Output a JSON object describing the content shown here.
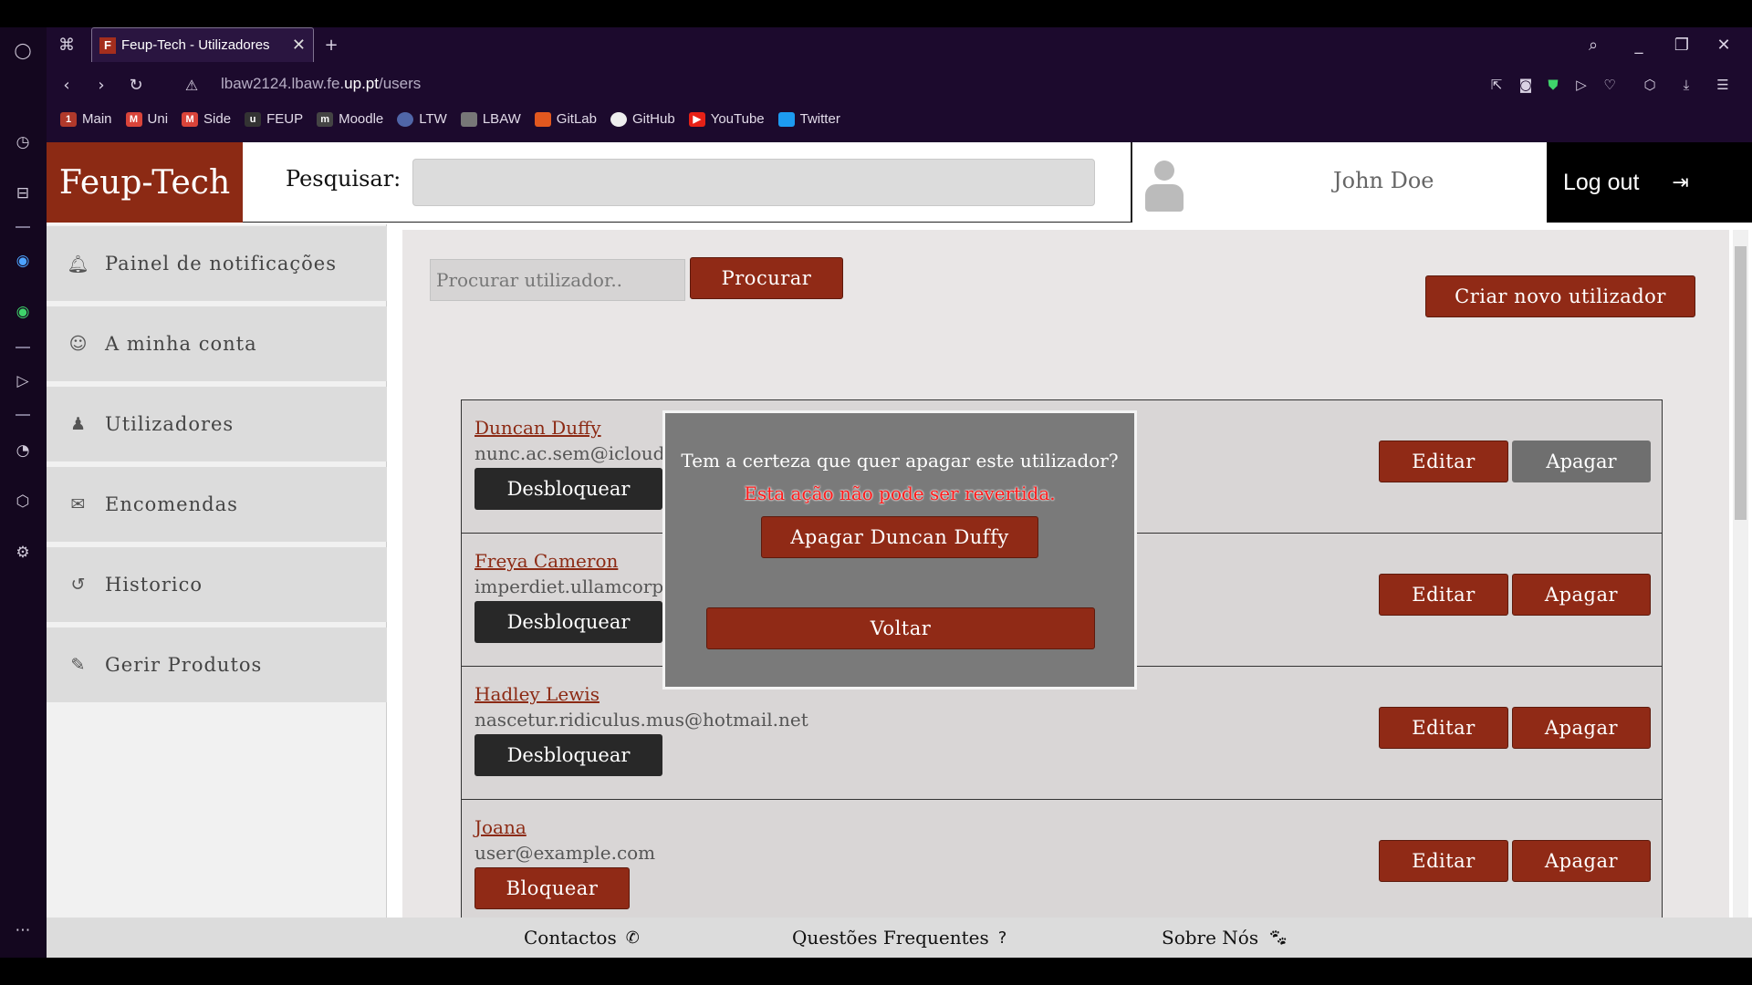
{
  "browser": {
    "tab_title": "Feup-Tech - Utilizadores",
    "url_pre": "lbaw2124.lbaw.fe.",
    "url_host": "up.pt",
    "url_path": "/users",
    "bookmarks": [
      "Main",
      "Uni",
      "Side",
      "FEUP",
      "Moodle",
      "LTW",
      "LBAW",
      "GitLab",
      "GitHub",
      "YouTube",
      "Twitter"
    ]
  },
  "header": {
    "logo": "Feup-Tech",
    "search_label": "Pesquisar:",
    "username": "John Doe",
    "logout": "Log out"
  },
  "nav": {
    "items": [
      {
        "label": "Painel de notificações",
        "icon": "bell-icon"
      },
      {
        "label": "A minha conta",
        "icon": "user-circle-icon"
      },
      {
        "label": "Utilizadores",
        "icon": "user-icon"
      },
      {
        "label": "Encomendas",
        "icon": "envelope-icon"
      },
      {
        "label": "Historico",
        "icon": "history-icon"
      },
      {
        "label": "Gerir Produtos",
        "icon": "edit-icon"
      }
    ]
  },
  "users_page": {
    "search_placeholder": "Procurar utilizador..",
    "search_button": "Procurar",
    "create_button": "Criar novo utilizador",
    "edit_label": "Editar",
    "delete_label": "Apagar",
    "users": [
      {
        "name": "Duncan Duffy",
        "email": "nunc.ac.sem@icloud.",
        "action": "Desbloquear"
      },
      {
        "name": "Freya Cameron",
        "email": "imperdiet.ullamcorpe",
        "action": "Desbloquear"
      },
      {
        "name": "Hadley Lewis",
        "email": "nascetur.ridiculus.mus@hotmail.net",
        "action": "Desbloquear"
      },
      {
        "name": "Joana",
        "email": "user@example.com",
        "action": "Bloquear"
      }
    ]
  },
  "modal": {
    "question": "Tem a certeza que quer apagar este utilizador?",
    "warning": "Esta ação não pode ser revertida.",
    "confirm": "Apagar Duncan Duffy",
    "back": "Voltar"
  },
  "footer": {
    "contacts": "Contactos",
    "faq": "Questões Frequentes",
    "about": "Sobre Nós"
  },
  "colors": {
    "brand": "#8c2a14",
    "dark_button": "#282828",
    "warning": "#ff1a1a"
  }
}
